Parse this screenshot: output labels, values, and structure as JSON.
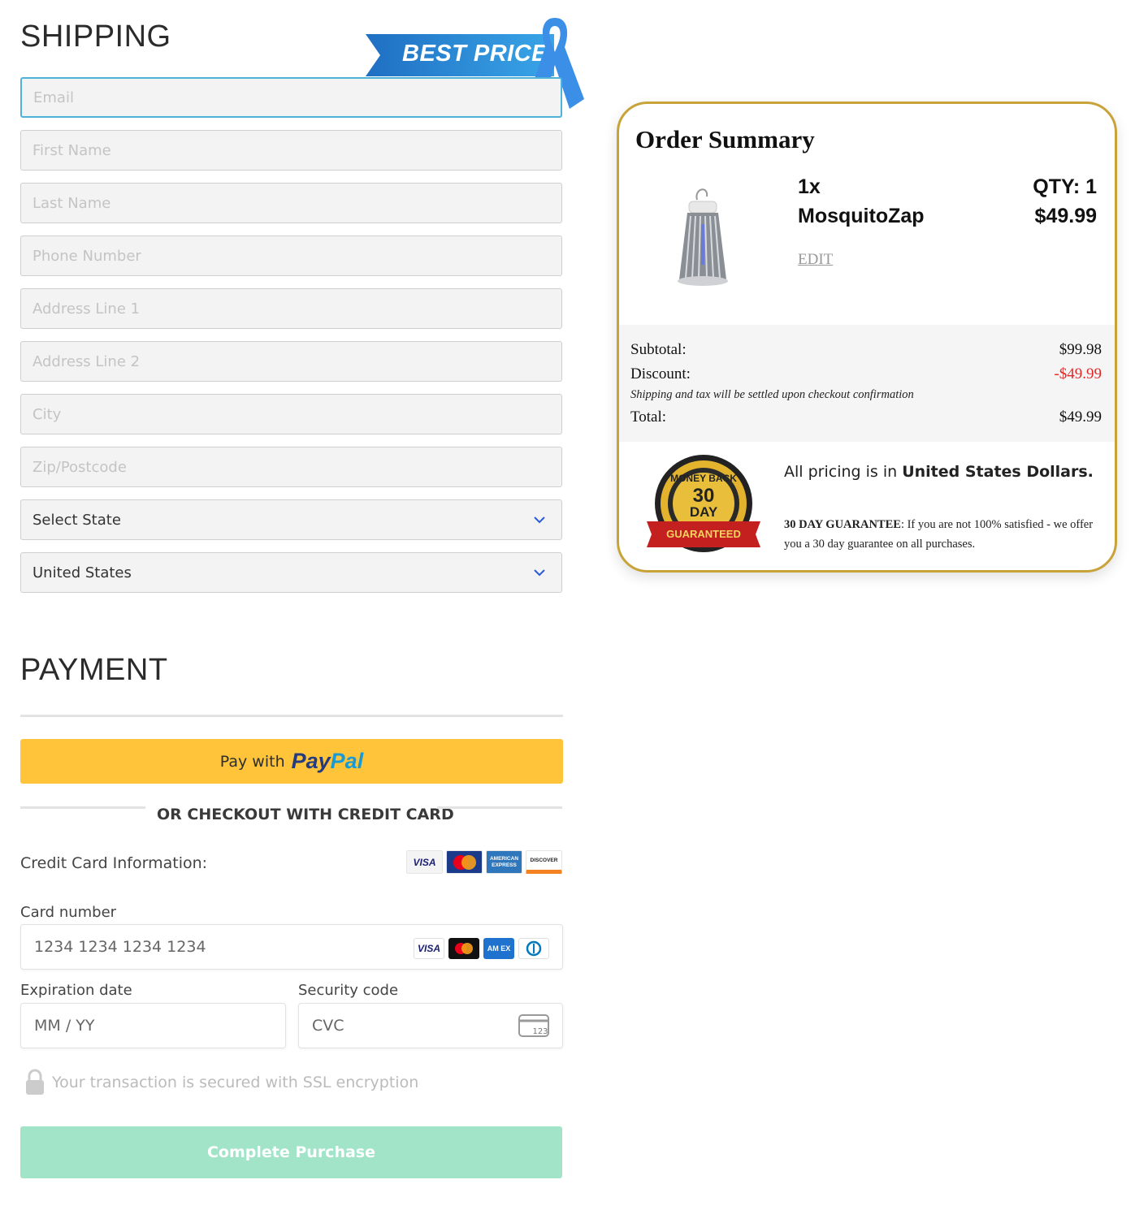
{
  "shipping": {
    "title": "SHIPPING",
    "badge": "BEST PRICE",
    "fields": [
      {
        "placeholder": "Email"
      },
      {
        "placeholder": "First Name"
      },
      {
        "placeholder": "Last Name"
      },
      {
        "placeholder": "Phone Number"
      },
      {
        "placeholder": "Address Line 1"
      },
      {
        "placeholder": "Address Line 2"
      },
      {
        "placeholder": "City"
      },
      {
        "placeholder": "Zip/Postcode"
      }
    ],
    "state_select": "Select State",
    "country_select": "United States"
  },
  "summary": {
    "title": "Order Summary",
    "item": {
      "qty": "1x",
      "name": "MosquitoZap",
      "qty_label": "QTY: 1",
      "price": "$49.99",
      "edit": "EDIT"
    },
    "subtotal_label": "Subtotal:",
    "subtotal": "$99.98",
    "discount_label": "Discount:",
    "discount": "-$49.99",
    "note": "Shipping and tax will be settled upon checkout confirmation",
    "total_label": "Total:",
    "total": "$49.99",
    "currency_prefix": "All pricing is in",
    "currency_name": "United States Dollars.",
    "guarantee_title": "30 DAY GUARANTEE",
    "guarantee_text": ": If you are not 100% satisfied - we offer you a 30 day guarantee on all purchases.",
    "seal": {
      "top": "MONEY BACK",
      "num": "30",
      "day": "DAY",
      "band": "GUARANTEED"
    },
    "border_color": "#c7a33a"
  },
  "payment": {
    "title": "PAYMENT",
    "paypal_prefix": "Pay with",
    "paypal_pay": "Pay",
    "paypal_pal": "Pal",
    "or_text": "OR CHECKOUT WITH CREDIT CARD",
    "cc_info": "Credit Card Information:",
    "card_logos": [
      "VISA",
      "MasterCard",
      "AMERICAN EXPRESS",
      "DISCOVER"
    ],
    "card_number_label": "Card number",
    "card_number_placeholder": "1234 1234 1234 1234",
    "mini_logos": [
      "VISA",
      "mastercard-icon",
      "AM EX",
      "diners-icon"
    ],
    "exp_label": "Expiration date",
    "exp_placeholder": "MM / YY",
    "cvc_label": "Security code",
    "cvc_placeholder": "CVC",
    "cvc_icon_text": "123",
    "ssl_text": "Your transaction is secured with SSL encryption",
    "complete_button": "Complete Purchase",
    "paypal_color": "#ffc43a",
    "complete_color": "#a2e4c8"
  }
}
